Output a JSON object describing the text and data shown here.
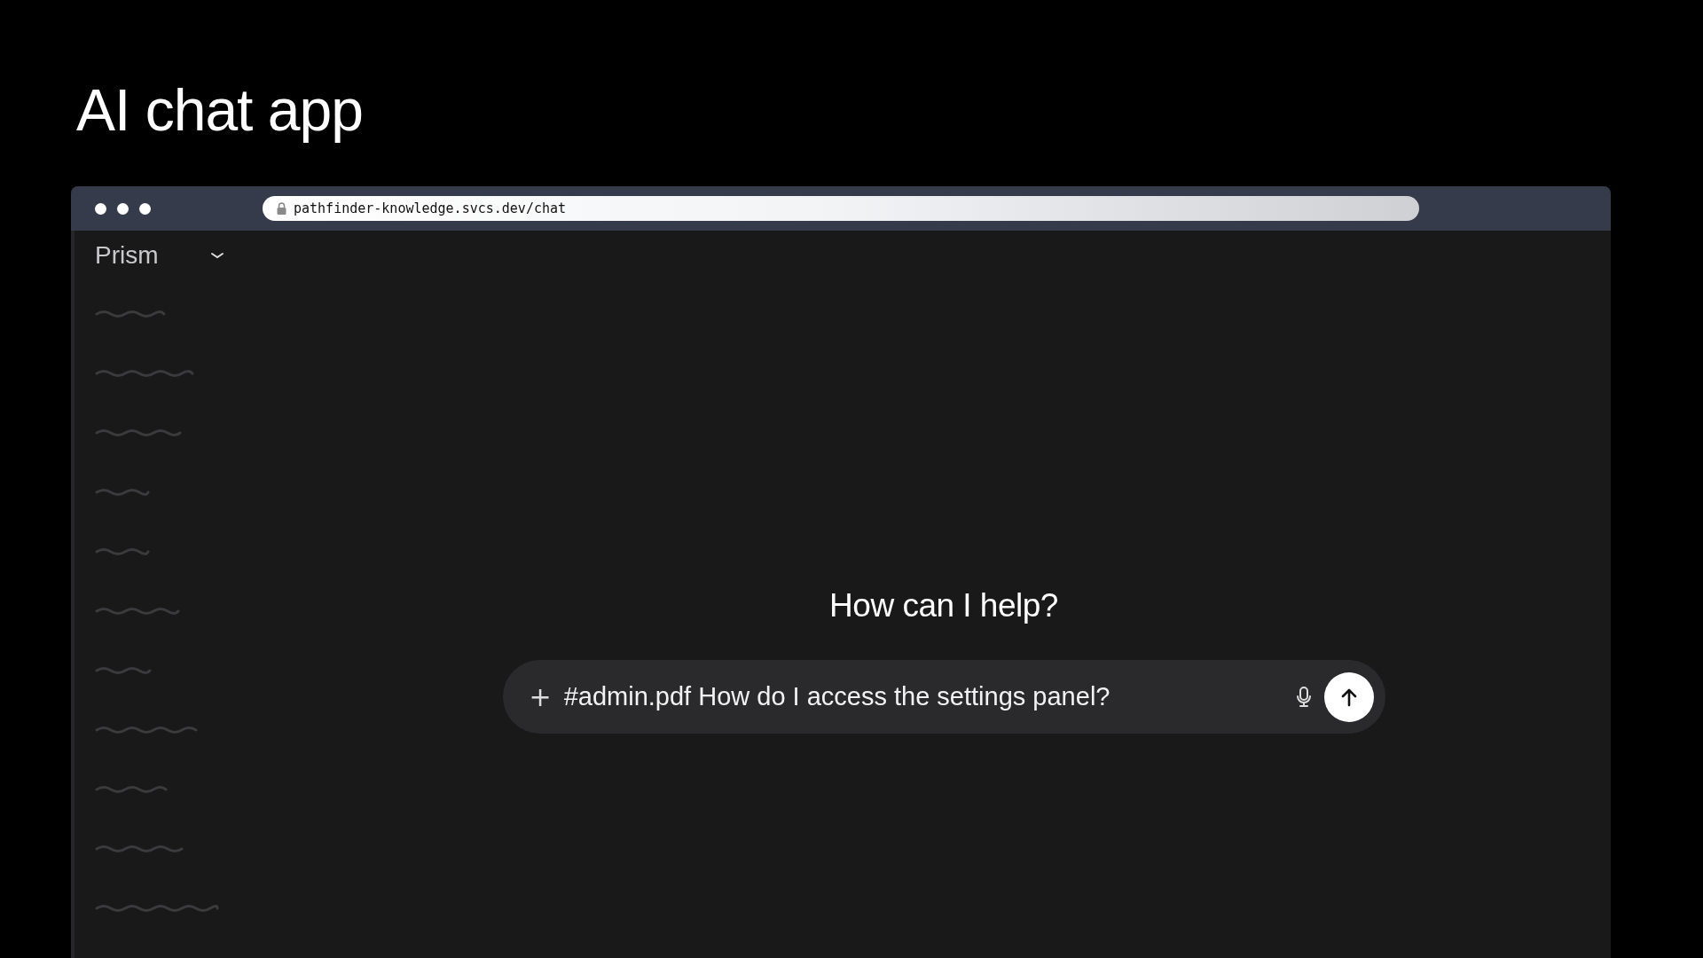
{
  "slide_title": "AI chat app",
  "browser": {
    "address": "pathfinder-knowledge.svcs.dev/chat"
  },
  "sidebar": {
    "workspace": "Prism"
  },
  "main": {
    "heading": "How can I help?",
    "composer": {
      "value": "#admin.pdf How do I access the settings panel?",
      "add": "+"
    }
  }
}
